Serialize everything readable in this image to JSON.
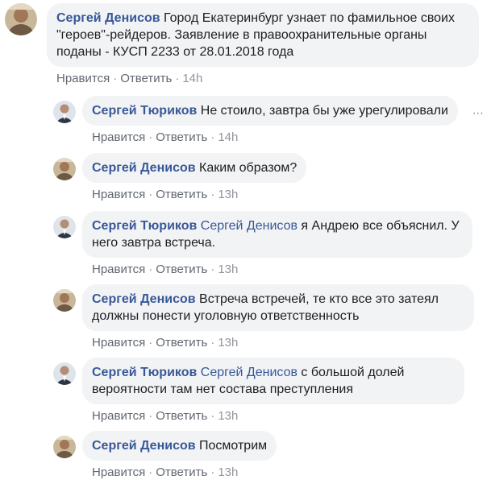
{
  "comments": [
    {
      "author": "Сергей Денисов",
      "mention": "",
      "text": "Город Екатеринбург узнает по фамильное своих \"героев\"-рейдеров. Заявление в правоохранительные органы поданы - КУСП 2233 от 28.01.2018 года",
      "like": "Нравится",
      "reply": "Ответить",
      "time": "14h"
    },
    {
      "author": "Сергей Тюриков",
      "mention": "",
      "text": "Не стоило, завтра бы уже урегулировали",
      "like": "Нравится",
      "reply": "Ответить",
      "time": "14h"
    },
    {
      "author": "Сергей Денисов",
      "mention": "",
      "text": "Каким образом?",
      "like": "Нравится",
      "reply": "Ответить",
      "time": "13h"
    },
    {
      "author": "Сергей Тюриков",
      "mention": "Сергей Денисов",
      "text": "я Андрею все объяснил. У него завтра встреча.",
      "like": "Нравится",
      "reply": "Ответить",
      "time": "13h"
    },
    {
      "author": "Сергей Денисов",
      "mention": "",
      "text": "Встреча встречей, те кто все это затеял должны понести уголовную ответственность",
      "like": "Нравится",
      "reply": "Ответить",
      "time": "13h"
    },
    {
      "author": "Сергей Тюриков",
      "mention": "Сергей Денисов",
      "text": "с большой долей вероятности там нет состава преступления",
      "like": "Нравится",
      "reply": "Ответить",
      "time": "13h"
    },
    {
      "author": "Сергей Денисов",
      "mention": "",
      "text": "Посмотрим",
      "like": "Нравится",
      "reply": "Ответить",
      "time": "13h"
    }
  ],
  "separator": "·",
  "more_icon": "ellipsis-icon",
  "colors": {
    "author": "#385898",
    "bubble": "#f2f3f5",
    "meta": "#90949c"
  }
}
